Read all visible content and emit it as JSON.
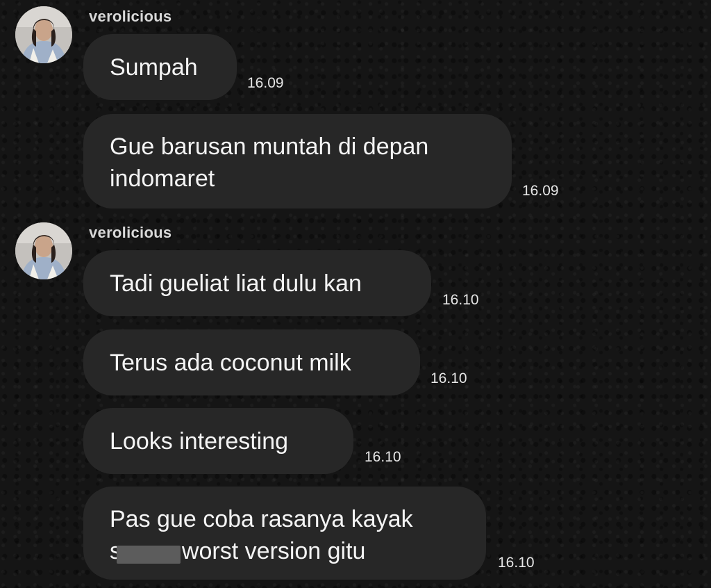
{
  "conversation": {
    "groups": [
      {
        "sender": "verolicious",
        "messages": [
          {
            "lines": [
              "Sumpah"
            ],
            "time": "16.09"
          },
          {
            "lines": [
              "Gue barusan muntah di depan",
              "indomaret"
            ],
            "time": "16.09"
          }
        ]
      },
      {
        "sender": "verolicious",
        "messages": [
          {
            "lines": [
              "Tadi gueliat liat dulu kan"
            ],
            "time": "16.10"
          },
          {
            "lines": [
              "Terus ada coconut milk"
            ],
            "time": "16.10"
          },
          {
            "lines": [
              "Looks interesting"
            ],
            "time": "16.10"
          },
          {
            "lines": [
              "Pas gue coba rasanya kayak",
              "sperm worst version gitu"
            ],
            "time": "16.10"
          }
        ]
      }
    ]
  },
  "colors": {
    "background": "#151515",
    "bubble": "#272727",
    "text": "#f4f4f4",
    "username": "#d8d8d8"
  },
  "icons": [
    "avatar-photo"
  ],
  "redaction": "grey box over part of the word 'sperm'"
}
